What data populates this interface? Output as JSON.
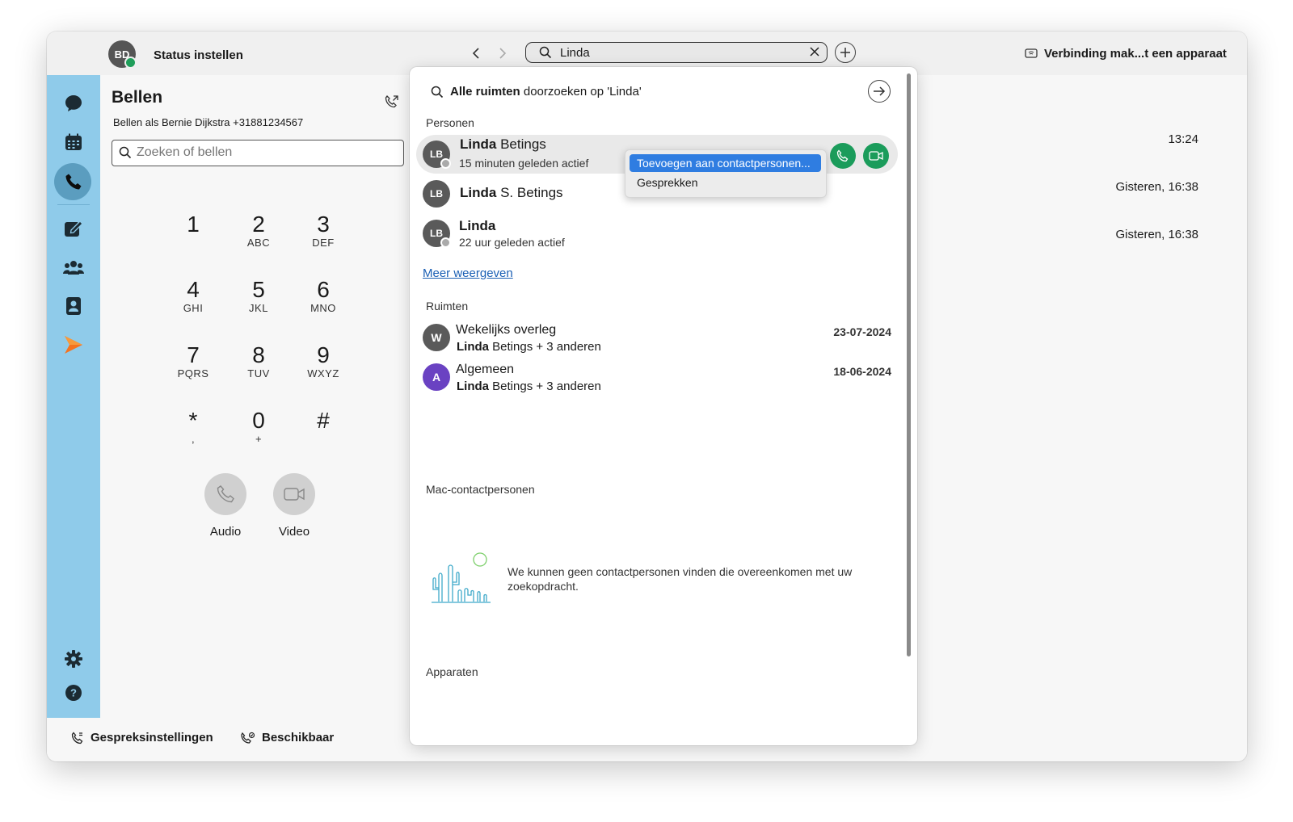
{
  "titlebar": {
    "avatar_initials": "BD",
    "status_label": "Status instellen",
    "search_value": "Linda",
    "connect_label": "Verbinding mak...t een apparaat"
  },
  "sidebar": {
    "items": [
      "chat-icon",
      "calendar-icon",
      "phone-icon",
      "compose-icon",
      "team-icon",
      "contacts-icon",
      "arrow-app-icon",
      "gear-icon",
      "help-icon"
    ],
    "active_item": "phone-icon",
    "accent_color": "#8fcbea"
  },
  "left_panel": {
    "title": "Bellen",
    "subtitle": "Bellen als Bernie Dijkstra +31881234567",
    "search_placeholder": "Zoeken of bellen",
    "keys": [
      {
        "digit": "1",
        "letters": ""
      },
      {
        "digit": "2",
        "letters": "ABC"
      },
      {
        "digit": "3",
        "letters": "DEF"
      },
      {
        "digit": "4",
        "letters": "GHI"
      },
      {
        "digit": "5",
        "letters": "JKL"
      },
      {
        "digit": "6",
        "letters": "MNO"
      },
      {
        "digit": "7",
        "letters": "PQRS"
      },
      {
        "digit": "8",
        "letters": "TUV"
      },
      {
        "digit": "9",
        "letters": "WXYZ"
      },
      {
        "digit": "*",
        "letters": ","
      },
      {
        "digit": "0",
        "letters": "+"
      },
      {
        "digit": "#",
        "letters": ""
      }
    ],
    "audio_label": "Audio",
    "video_label": "Video"
  },
  "bottombar": {
    "settings_label": "Gespreksinstellingen",
    "availability_label": "Beschikbaar"
  },
  "right_area": {
    "times": [
      "13:24",
      "Gisteren, 16:38",
      "Gisteren, 16:38"
    ]
  },
  "dropdown": {
    "search_all_bold": "Alle ruimten",
    "search_all_rest": " doorzoeken op 'Linda'",
    "people_label": "Personen",
    "people": [
      {
        "initials": "LB",
        "name_bold": "Linda",
        "name_rest": " Betings",
        "sub": "15 minuten geleden actief"
      },
      {
        "initials": "LB",
        "name_bold": "Linda",
        "name_rest": " S. Betings",
        "sub": ""
      },
      {
        "initials": "LB",
        "name_bold": "Linda",
        "name_rest": "",
        "sub": "22 uur geleden actief"
      }
    ],
    "context_menu": [
      "Toevoegen aan contactpersonen...",
      "Gesprekken"
    ],
    "more_link": "Meer weergeven",
    "rooms_label": "Ruimten",
    "rooms": [
      {
        "initial": "W",
        "name": "Wekelijks overleg",
        "members_bold": "Linda",
        "members_rest": " Betings + 3 anderen",
        "date": "23-07-2024"
      },
      {
        "initial": "A",
        "name": "Algemeen",
        "members_bold": "Linda",
        "members_rest": " Betings + 3 anderen",
        "date": "18-06-2024"
      }
    ],
    "mac_contacts_label": "Mac-contactpersonen",
    "empty_message": "We kunnen geen contactpersonen vinden die overeenkomen met uw zoekopdracht.",
    "devices_label": "Apparaten"
  }
}
